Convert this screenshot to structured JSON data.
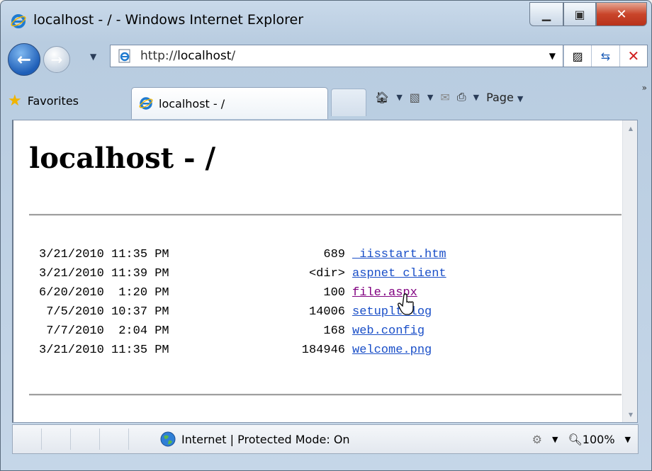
{
  "window": {
    "title": "localhost - / - Windows Internet Explorer"
  },
  "address": {
    "prefix": "http://",
    "host": "localhost",
    "suffix": "/"
  },
  "favorites": {
    "label": "Favorites"
  },
  "tab": {
    "label": "localhost - /"
  },
  "commands": {
    "page_label": "Page"
  },
  "page": {
    "title": "localhost - /",
    "listing": [
      {
        "date": "3/21/2010 11:35 PM",
        "size": "689",
        "name": "_iisstart.htm",
        "visited": false
      },
      {
        "date": "3/21/2010 11:39 PM",
        "size": "<dir>",
        "name": "aspnet_client",
        "visited": false
      },
      {
        "date": "6/20/2010  1:20 PM",
        "size": "100",
        "name": "file.aspx",
        "visited": true
      },
      {
        "date": " 7/5/2010 10:37 PM",
        "size": "14006",
        "name": "setuplt.log",
        "visited": false
      },
      {
        "date": " 7/7/2010  2:04 PM",
        "size": "168",
        "name": "web.config",
        "visited": false
      },
      {
        "date": "3/21/2010 11:35 PM",
        "size": "184946",
        "name": "welcome.png",
        "visited": false
      }
    ]
  },
  "status": {
    "zone": "Internet | Protected Mode: On",
    "zoom": "100%"
  },
  "colors": {
    "link": "#1a4fc8",
    "visited": "#800080",
    "close": "#c9452a"
  }
}
